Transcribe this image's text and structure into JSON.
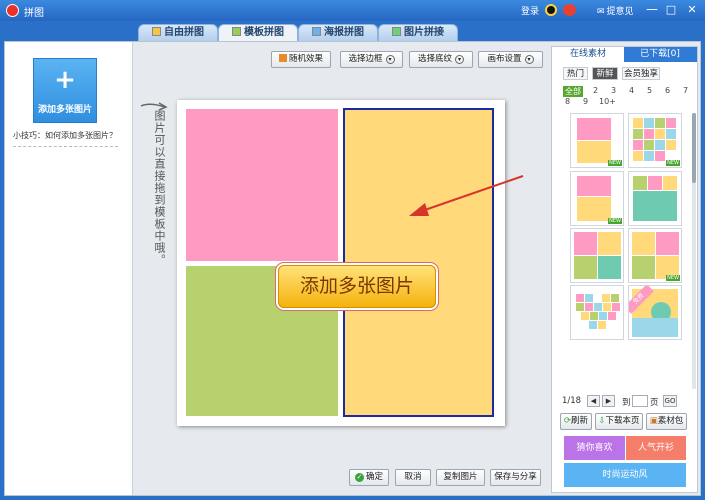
{
  "window": {
    "title": "拼图",
    "login": "登录",
    "feedback": "提意见",
    "minimize_glyph": "—",
    "maximize_glyph": "□",
    "close_glyph": "✕"
  },
  "tabs": [
    {
      "label": "自由拼图"
    },
    {
      "label": "模板拼图"
    },
    {
      "label": "海报拼图"
    },
    {
      "label": "图片拼接"
    }
  ],
  "left_panel": {
    "add_plus": "+",
    "add_label": "添加多张图片",
    "tip": "小技巧：如何添加多张图片？"
  },
  "toolbar": {
    "random": "随机效果",
    "border": "选择边框",
    "texture": "选择底纹",
    "canvas_settings": "画布设置"
  },
  "canvas": {
    "hand_note": "图片可以直接拖到模板中哦。",
    "callout": "添加多张图片",
    "colors": {
      "pink": "#ff9ac3",
      "yellow": "#ffd97a",
      "green": "#b7d16e",
      "frame_border": "#1d2aa6",
      "arrow": "#d7352b"
    }
  },
  "bottom": {
    "confirm": "确定",
    "cancel": "取消",
    "copy": "复制图片",
    "save_share": "保存与分享"
  },
  "right_panel": {
    "tab_online": "在线素材",
    "tab_downloaded": "已下载[0]",
    "filter_hot": "热门",
    "filter_new": "新鲜",
    "filter_member": "会员独享",
    "count_all": "全部",
    "counts": [
      "2",
      "3",
      "4",
      "5",
      "6",
      "7",
      "8",
      "9",
      "10+"
    ],
    "new_badge": "NEW",
    "free_badge": "免费",
    "page": "1/18",
    "prev": "◀",
    "next": "▶",
    "goto_prefix": "到",
    "goto_suffix": "页",
    "go": "GO",
    "refresh": "刷新",
    "download_page": "下载本页",
    "material_pack": "素材包",
    "banner_guess": "猜你喜欢",
    "banner_popular": "人气开衫",
    "banner_sport": "时尚运动风"
  }
}
